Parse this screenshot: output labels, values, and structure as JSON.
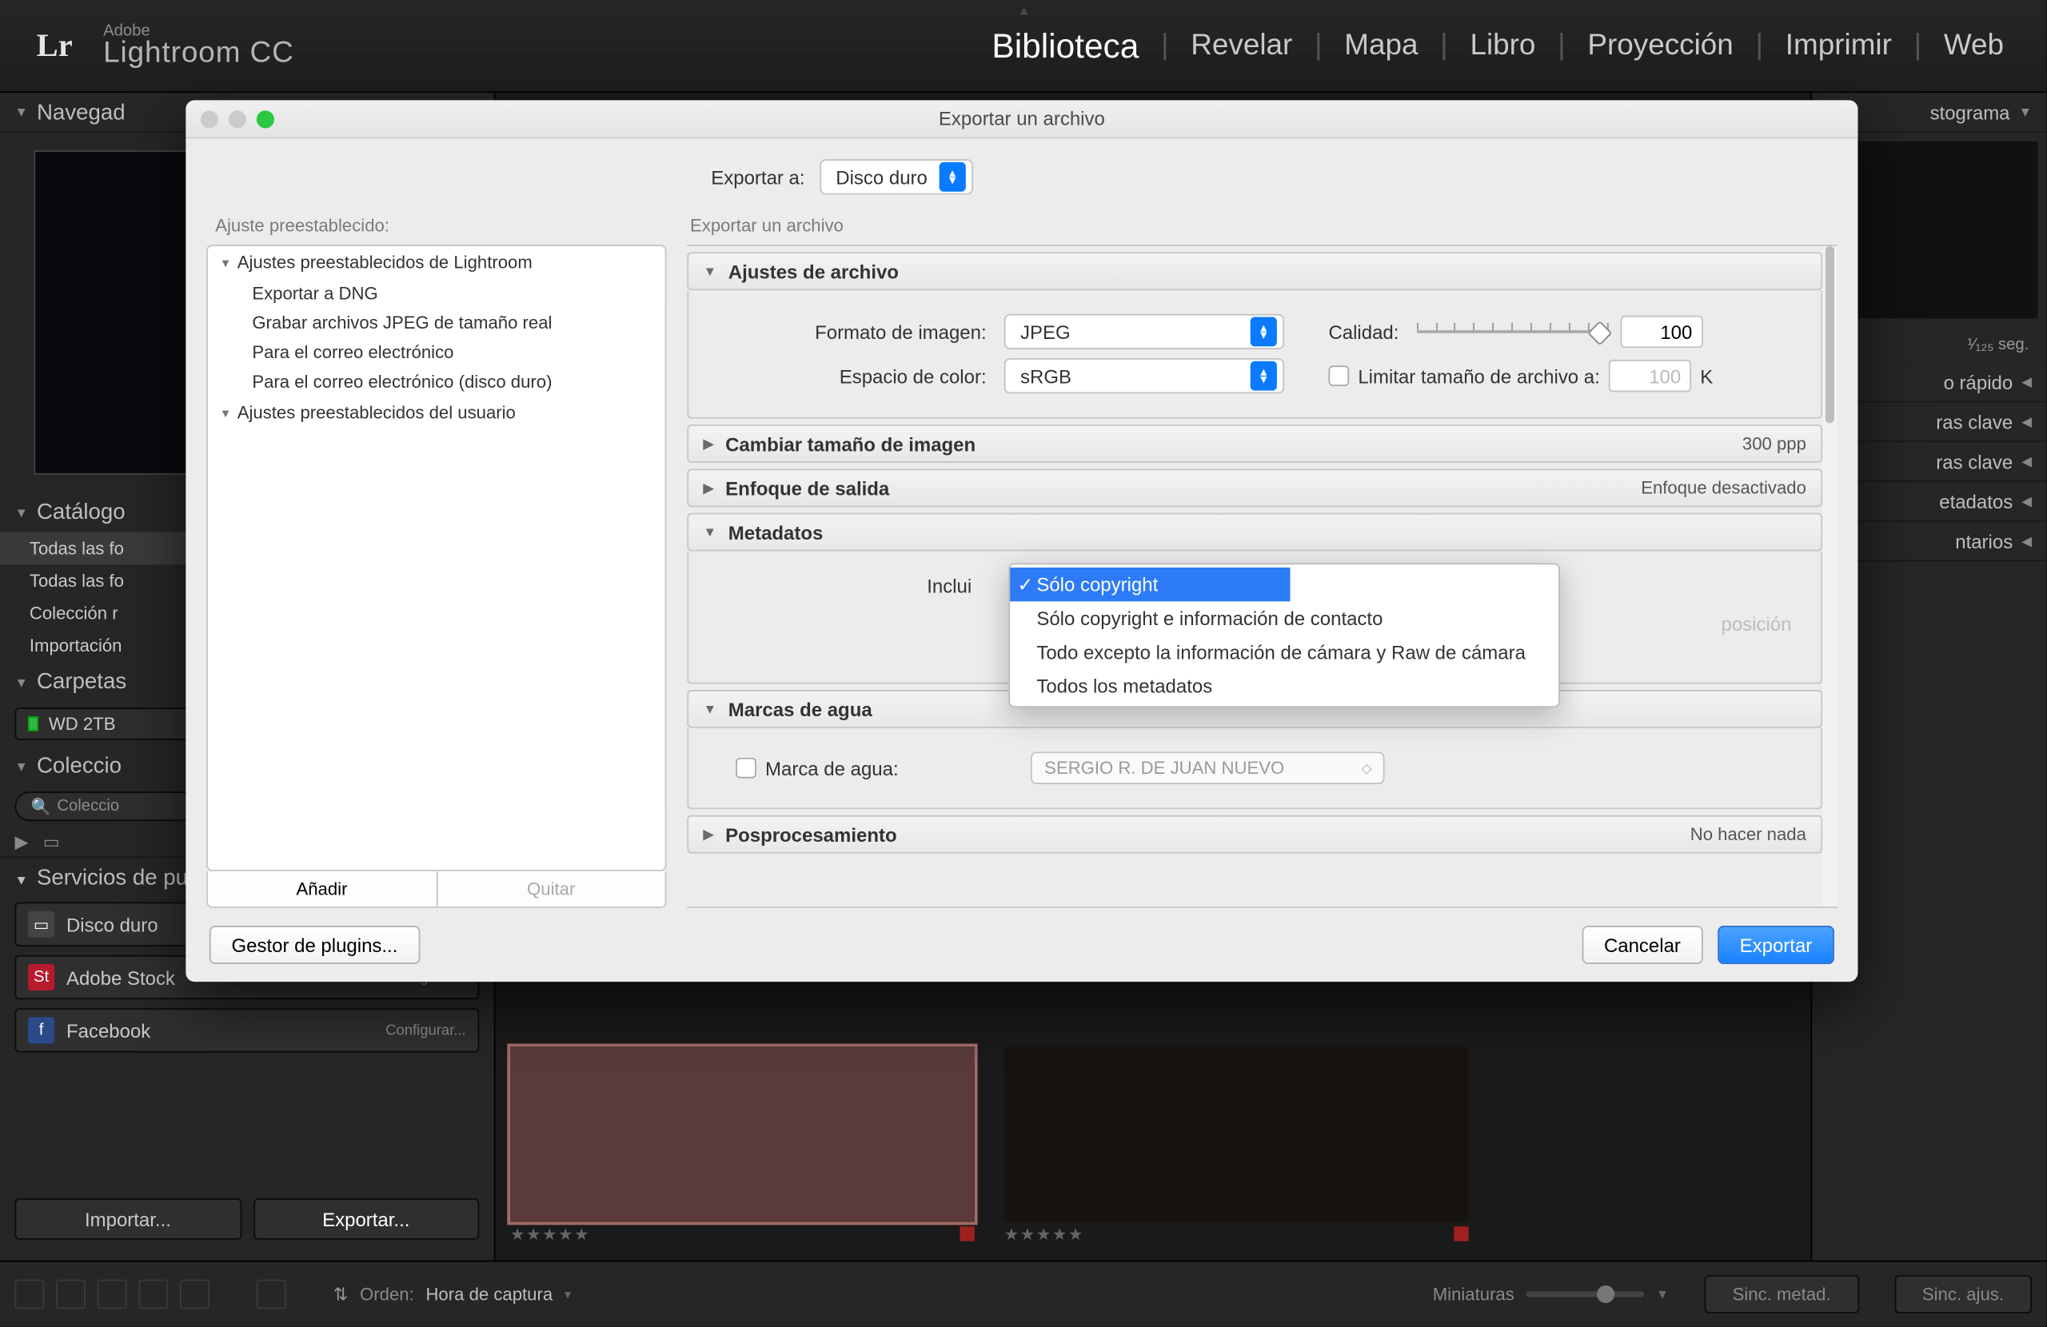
{
  "app": {
    "vendor": "Adobe",
    "name": "Lightroom CC"
  },
  "modules": {
    "biblioteca": "Biblioteca",
    "revelar": "Revelar",
    "mapa": "Mapa",
    "libro": "Libro",
    "proyeccion": "Proyección",
    "imprimir": "Imprimir",
    "web": "Web"
  },
  "left": {
    "navegador": "Navegad",
    "catalogo": "Catálogo",
    "catalog_items": [
      "Todas las fo",
      "Todas las fo",
      "Colección r",
      "Importación"
    ],
    "carpetas": "Carpetas",
    "drive": "WD 2TB",
    "colecciones": "Coleccio",
    "coll_search": "Coleccio",
    "servicios": "Servicios de publicación",
    "pub": {
      "hd": "Disco duro",
      "as": "Adobe Stock",
      "fb": "Facebook",
      "cfg": "Configurar..."
    },
    "importar": "Importar...",
    "exportar": "Exportar..."
  },
  "right": {
    "histograma": "stograma",
    "shutter": "¹⁄₁₂₅ seg.",
    "rapido": "o rápido",
    "clave1": "ras clave",
    "clave2": "ras clave",
    "metadatos": "etadatos",
    "comentarios": "ntarios"
  },
  "bottom": {
    "orden_lbl": "Orden:",
    "orden_val": "Hora de captura",
    "miniaturas": "Miniaturas",
    "sinc_metad": "Sinc. metad.",
    "sinc_ajus": "Sinc. ajus."
  },
  "dialog": {
    "title": "Exportar un archivo",
    "export_to_lbl": "Exportar a:",
    "export_to_val": "Disco duro",
    "preset_lbl": "Ajuste preestablecido:",
    "settings_lbl": "Exportar un archivo",
    "preset_groups": {
      "lr": "Ajustes preestablecidos de Lightroom",
      "user": "Ajustes preestablecidos del usuario"
    },
    "preset_items": [
      "Exportar a DNG",
      "Grabar archivos JPEG de tamaño real",
      "Para el correo electrónico",
      "Para el correo electrónico (disco duro)"
    ],
    "anadir": "Añadir",
    "quitar": "Quitar",
    "sections": {
      "ajustes_archivo": "Ajustes de archivo",
      "formato_lbl": "Formato de imagen:",
      "formato_val": "JPEG",
      "espacio_lbl": "Espacio de color:",
      "espacio_val": "sRGB",
      "calidad_lbl": "Calidad:",
      "calidad_val": "100",
      "limitar_lbl": "Limitar tamaño de archivo a:",
      "limitar_val": "100",
      "limitar_unit": "K",
      "cambiar_tamano": "Cambiar tamaño de imagen",
      "cambiar_tamano_r": "300 ppp",
      "enfoque": "Enfoque de salida",
      "enfoque_r": "Enfoque desactivado",
      "metadatos": "Metadatos",
      "incluir_lbl": "Inclui",
      "meta_options": [
        "Sólo copyright",
        "Sólo copyright e información de contacto",
        "Todo excepto la información de cámara y Raw de cámara",
        "Todos los metadatos"
      ],
      "posicion": "posición",
      "marcas_agua": "Marcas de agua",
      "marca_lbl": "Marca de agua:",
      "marca_sel": "SERGIO R. DE JUAN NUEVO",
      "posproc": "Posprocesamiento",
      "posproc_r": "No hacer nada"
    },
    "gestor": "Gestor de plugins...",
    "cancelar": "Cancelar",
    "exportar": "Exportar"
  }
}
